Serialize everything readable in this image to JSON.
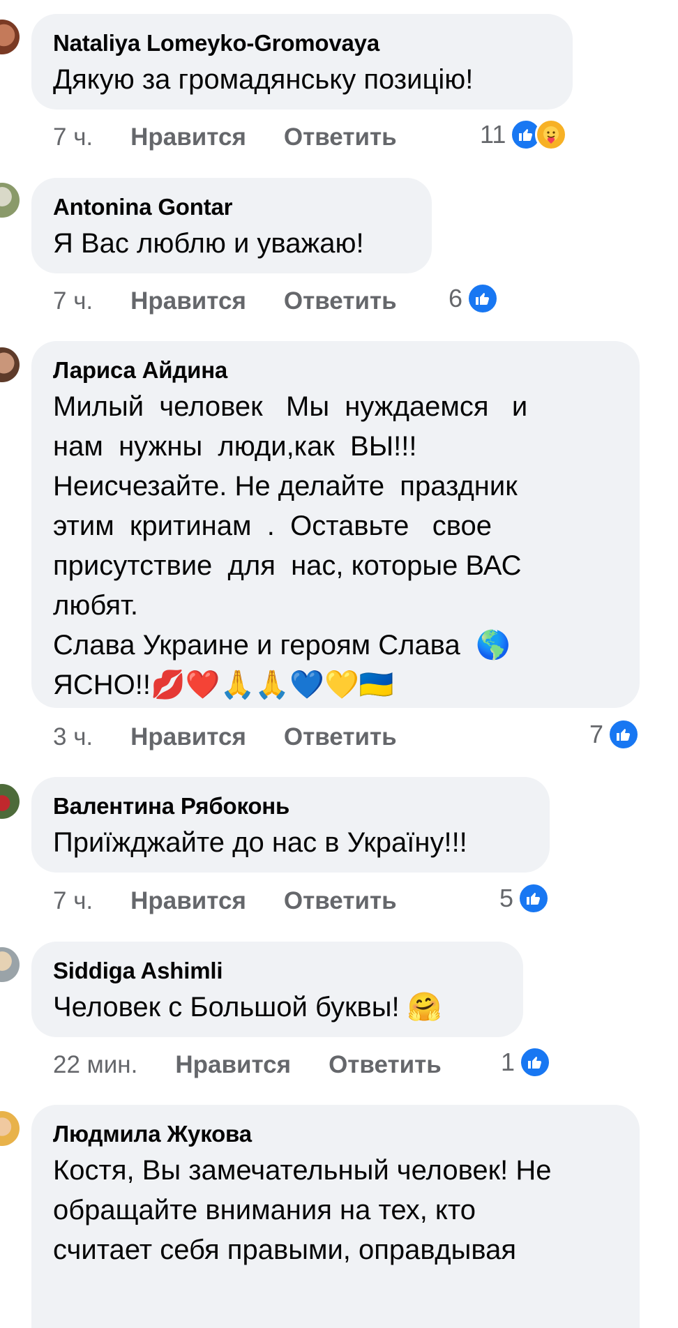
{
  "comments": [
    {
      "author": "Nataliya Lomeyko-Gromovaya",
      "text": "Дякую за громадянську позицію!",
      "time": "7 ч.",
      "like_label": "Нравится",
      "reply_label": "Ответить",
      "reaction_count": "11",
      "reactions": [
        "like-icon",
        "care-icon"
      ]
    },
    {
      "author": "Antonina Gontar",
      "text": "Я Вас люблю и уважаю!",
      "time": "7 ч.",
      "like_label": "Нравится",
      "reply_label": "Ответить",
      "reaction_count": "6",
      "reactions": [
        "like-icon"
      ]
    },
    {
      "author": "Лариса Айдина",
      "text": "Милый  человек   Мы  нуждаемся   и\nнам  нужны  люди,как  ВЫ!!!\nНеисчезайте. Не делайте  праздник\nэтим  критинам  .  Оставьте   свое\nприсутствие  для  нас, которые ВАС\nлюбят.\nСлава Украине и героям Слава  🌎\nЯСНО!!💋❤️🙏🙏💙💛🇺🇦",
      "time": "3 ч.",
      "like_label": "Нравится",
      "reply_label": "Ответить",
      "reaction_count": "7",
      "reactions": [
        "like-icon"
      ]
    },
    {
      "author": "Валентина Рябоконь",
      "text": "Приїжджайте до нас в Україну!!!",
      "time": "7 ч.",
      "like_label": "Нравится",
      "reply_label": "Ответить",
      "reaction_count": "5",
      "reactions": [
        "like-icon"
      ]
    },
    {
      "author": "Siddiga Ashimli",
      "text": "Человек с Большой буквы! 🤗",
      "time": "22 мин.",
      "like_label": "Нравится",
      "reply_label": "Ответить",
      "reaction_count": "1",
      "reactions": [
        "like-icon"
      ]
    },
    {
      "author": "Людмила Жукова",
      "text": "Костя, Вы замечательный человек! Не\nобращайте внимания на тех, кто\nсчитает себя правыми, оправдывая",
      "time": "",
      "like_label": "",
      "reply_label": "",
      "reaction_count": "",
      "reactions": []
    }
  ],
  "colors": {
    "bubble": "#f0f2f5",
    "meta": "#65676b",
    "like_blue": "#1877f2"
  }
}
